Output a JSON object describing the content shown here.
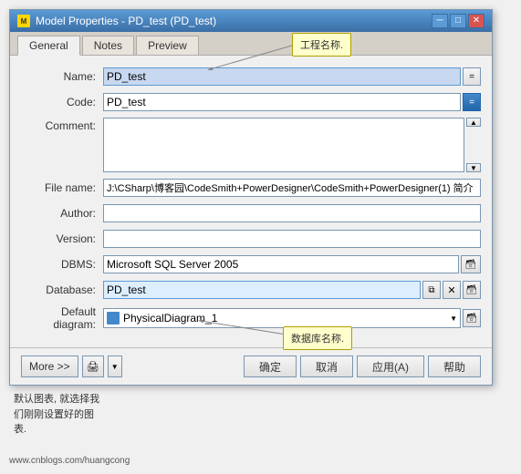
{
  "window": {
    "title": "Model Properties - PD_test (PD_test)",
    "icon": "M"
  },
  "title_buttons": {
    "minimize": "─",
    "maximize": "□",
    "close": "✕"
  },
  "tabs": [
    {
      "label": "General",
      "active": true
    },
    {
      "label": "Notes",
      "active": false
    },
    {
      "label": "Preview",
      "active": false
    }
  ],
  "form": {
    "name_label": "Name:",
    "name_value": "PD_test",
    "code_label": "Code:",
    "code_value": "PD_test",
    "comment_label": "Comment:",
    "comment_value": "",
    "filename_label": "File name:",
    "filename_value": "J:\\CSharp\\博客园\\CodeSmith+PowerDesigner\\CodeSmith+PowerDesigner(1) 简介",
    "author_label": "Author:",
    "author_value": "",
    "version_label": "Version:",
    "version_value": "",
    "dbms_label": "DBMS:",
    "dbms_value": "Microsoft SQL Server 2005",
    "database_label": "Database:",
    "database_value": "PD_test",
    "default_diagram_label": "Default diagram:",
    "default_diagram_value": "PhysicalDiagram_1"
  },
  "buttons": {
    "more": "More >>",
    "ok": "确定",
    "cancel": "取消",
    "apply": "应用(A)",
    "help": "帮助"
  },
  "callouts": {
    "project_name": "工程名称.",
    "database_name": "数据库名称."
  },
  "bottom_note": {
    "line1": "默认图表, 就选择我",
    "line2": "们刚刚设置好的图",
    "line3": "表.",
    "website": "www.cnblogs.com/huangcong"
  }
}
